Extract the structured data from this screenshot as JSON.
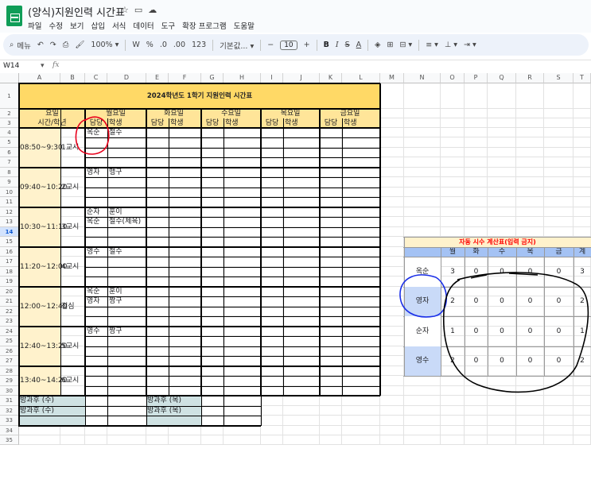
{
  "app": {
    "doc_title": "(양식)지원인력 시간표",
    "title_icons": [
      "star-icon",
      "move-folder-icon",
      "cloud-status-icon"
    ],
    "menu": [
      "파일",
      "수정",
      "보기",
      "삽입",
      "서식",
      "데이터",
      "도구",
      "확장 프로그램",
      "도움말"
    ]
  },
  "toolbar": {
    "search_label": "메뉴",
    "zoom": "100%",
    "currency": "W",
    "percent": "%",
    "dec_decrease": ".0",
    "dec_increase": ".00",
    "number_format": "123",
    "font": "기본값...",
    "minus": "−",
    "font_size": "10",
    "plus": "+",
    "bold": "B",
    "italic": "I",
    "strike": "S",
    "text_color": "A"
  },
  "formula_bar": {
    "name_box": "W14",
    "fx": "fx",
    "value": ""
  },
  "columns": [
    "A",
    "B",
    "C",
    "D",
    "E",
    "F",
    "G",
    "H",
    "I",
    "J",
    "K",
    "L",
    "M",
    "N",
    "O",
    "P",
    "Q",
    "R",
    "S",
    "T"
  ],
  "rows": [
    "1",
    "2",
    "3",
    "4",
    "5",
    "6",
    "7",
    "8",
    "9",
    "10",
    "11",
    "12",
    "13",
    "14",
    "15",
    "16",
    "17",
    "18",
    "19",
    "20",
    "21",
    "22",
    "23",
    "24",
    "25",
    "26",
    "27",
    "28",
    "29",
    "30",
    "31",
    "32",
    "33",
    "34",
    "35"
  ],
  "selected_row": "14",
  "schedule": {
    "title": "2024학년도 1학기 지원인력 시간표",
    "corner_top": "요일",
    "corner_bottom": "시간/학년",
    "days": [
      "월요일",
      "화요일",
      "수요일",
      "목요일",
      "금요일"
    ],
    "sub_headers": [
      "담당",
      "학생"
    ],
    "periods": [
      {
        "time": "08:50~9:30",
        "label": "1교시",
        "entries": [
          {
            "staff": "옥순",
            "student": "철수"
          }
        ]
      },
      {
        "time": "09:40~10:20",
        "label": "2교시",
        "entries": [
          {
            "staff": "영자",
            "student": "맹구"
          }
        ]
      },
      {
        "time": "10:30~11:10",
        "label": "3교시",
        "entries": [
          {
            "staff": "순자",
            "student": "훈이"
          },
          {
            "staff": "옥순",
            "student": "철수(체육)"
          }
        ]
      },
      {
        "time": "11:20~12:00",
        "label": "4교시",
        "entries": [
          {
            "staff": "영수",
            "student": "철수"
          }
        ]
      },
      {
        "time": "12:00~12:40",
        "label": "점심",
        "entries": [
          {
            "staff": "옥순",
            "student": "훈이"
          },
          {
            "staff": "영자",
            "student": "짱구"
          }
        ]
      },
      {
        "time": "12:40~13:20",
        "label": "5교시",
        "entries": [
          {
            "staff": "영수",
            "student": "짱구"
          }
        ]
      },
      {
        "time": "13:40~14:20",
        "label": "6교시",
        "entries": []
      }
    ],
    "after_school": [
      {
        "left": "방과후 (수)",
        "right": "방과후 (목)"
      },
      {
        "left": "방과후 (수)",
        "right": "방과후 (목)"
      }
    ]
  },
  "calc": {
    "title": "자동 시수 계산표(입력 금지)",
    "headers": [
      "월",
      "화",
      "수",
      "목",
      "금",
      "계"
    ],
    "rows": [
      {
        "name": "옥순",
        "values": [
          "3",
          "0",
          "0",
          "0",
          "0",
          "3"
        ]
      },
      {
        "name": "영자",
        "values": [
          "2",
          "0",
          "0",
          "0",
          "0",
          "2"
        ]
      },
      {
        "name": "순자",
        "values": [
          "1",
          "0",
          "0",
          "0",
          "0",
          "1"
        ]
      },
      {
        "name": "영수",
        "values": [
          "2",
          "0",
          "0",
          "0",
          "0",
          "2"
        ]
      }
    ]
  },
  "colors": {
    "title_fill": "#ffd966",
    "header_fill": "#ffe599",
    "time_fill": "#fff2cc",
    "after_school_fill": "#cfe2e3",
    "calc_title_fill": "#fff2cc",
    "calc_title_text": "#ff0000",
    "calc_header_fill": "#a4c2f4",
    "calc_name_fill": "#c9daf8",
    "annotation_red": "#e8001c",
    "annotation_blue": "#1a2fe8",
    "annotation_black": "#000000"
  }
}
